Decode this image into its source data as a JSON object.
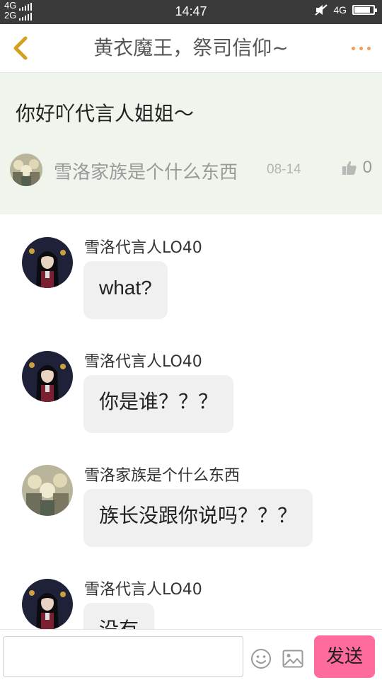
{
  "status_bar": {
    "network_top": "4G",
    "network_bottom": "2G",
    "time": "14:47",
    "network_right": "4G",
    "battery_level": 0.85
  },
  "header": {
    "title": "黄衣魔王，祭司信仰~",
    "back_icon": "chevron-left-icon",
    "more_icon": "more-dots-icon",
    "back_color": "#d4a020",
    "more_color": "#f39c5a"
  },
  "topic": {
    "text": "你好吖代言人姐姐～",
    "author": "雪洛家族是个什么东西",
    "date": "08-14",
    "like_count": "0",
    "like_icon": "thumbs-up-icon"
  },
  "messages": [
    {
      "sender": "雪洛代言人LO40",
      "text": "what?",
      "avatar": "dark-hair-avatar"
    },
    {
      "sender": "雪洛代言人LO40",
      "text": "你是谁？？？",
      "avatar": "dark-hair-avatar"
    },
    {
      "sender": "雪洛家族是个什么东西",
      "text": "族长没跟你说吗？？？",
      "avatar": "group-avatar"
    },
    {
      "sender": "雪洛代言人LO40",
      "text": "没有",
      "avatar": "dark-hair-avatar"
    }
  ],
  "input_bar": {
    "placeholder": "",
    "send_label": "发送",
    "emoji_icon": "emoji-icon",
    "image_icon": "image-icon",
    "send_color": "#ff6b9d"
  }
}
